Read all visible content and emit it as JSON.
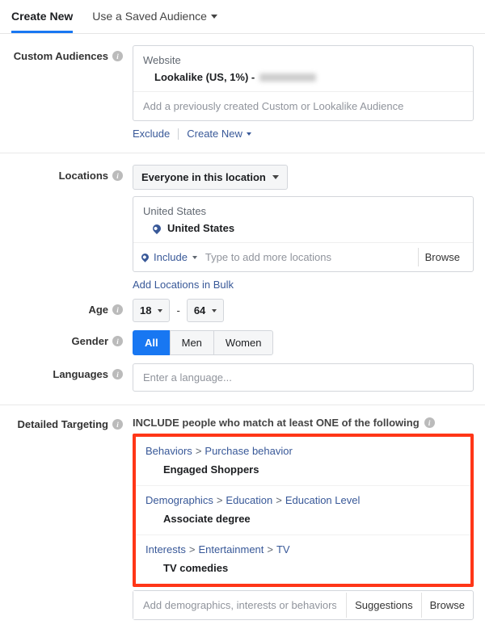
{
  "tabs": {
    "create_new": "Create New",
    "saved": "Use a Saved Audience"
  },
  "custom_audiences": {
    "label": "Custom Audiences",
    "website_label": "Website",
    "lookalike_text": "Lookalike (US, 1%) -",
    "placeholder": "Add a previously created Custom or Lookalike Audience",
    "exclude": "Exclude",
    "create_new": "Create New"
  },
  "locations": {
    "label": "Locations",
    "scope": "Everyone in this location",
    "country_header": "United States",
    "country_item": "United States",
    "include": "Include",
    "placeholder": "Type to add more locations",
    "browse": "Browse",
    "bulk": "Add Locations in Bulk"
  },
  "age": {
    "label": "Age",
    "min": "18",
    "max": "64"
  },
  "gender": {
    "label": "Gender",
    "all": "All",
    "men": "Men",
    "women": "Women"
  },
  "languages": {
    "label": "Languages",
    "placeholder": "Enter a language..."
  },
  "detailed": {
    "label": "Detailed Targeting",
    "header": "INCLUDE people who match at least ONE of the following",
    "items": [
      {
        "crumb": [
          "Behaviors",
          "Purchase behavior"
        ],
        "value": "Engaged Shoppers"
      },
      {
        "crumb": [
          "Demographics",
          "Education",
          "Education Level"
        ],
        "value": "Associate degree"
      },
      {
        "crumb": [
          "Interests",
          "Entertainment",
          "TV"
        ],
        "value": "TV comedies"
      }
    ],
    "placeholder": "Add demographics, interests or behaviors",
    "suggestions": "Suggestions",
    "browse": "Browse"
  }
}
